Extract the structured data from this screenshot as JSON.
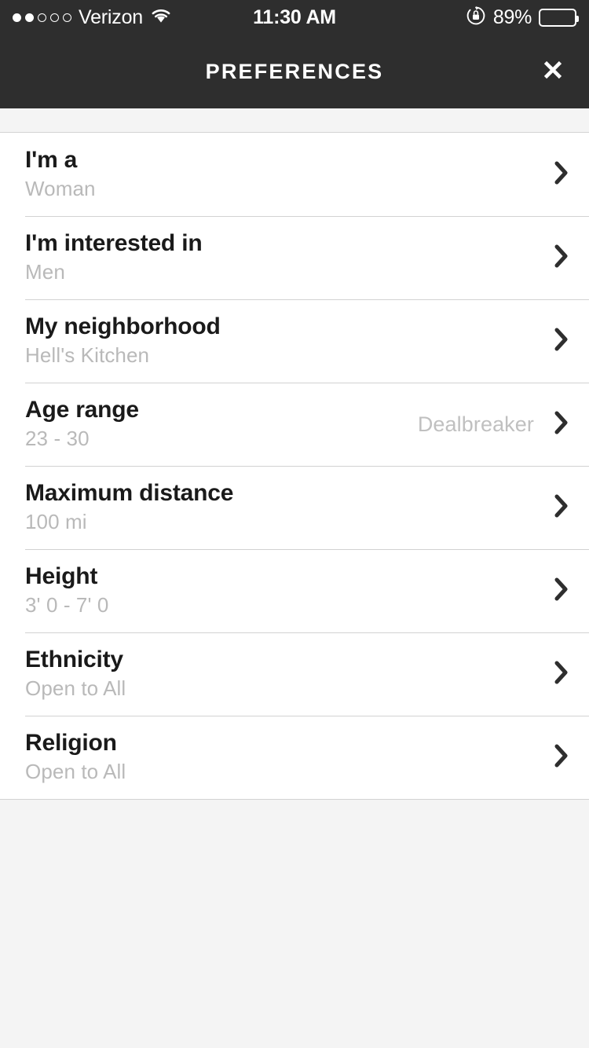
{
  "status_bar": {
    "carrier": "Verizon",
    "signal_dots_filled": 2,
    "signal_dots_total": 5,
    "wifi_icon": "wifi-icon",
    "time": "11:30 AM",
    "rotation_lock_icon": "rotation-lock-icon",
    "battery_percent": "89%",
    "battery_level": 89,
    "text_color": "#ffffff",
    "background": "#2e2e2e"
  },
  "header": {
    "title": "PREFERENCES",
    "close_icon": "close-icon",
    "background": "#2e2e2e"
  },
  "colors": {
    "page_background": "#f4f4f4",
    "list_background": "#ffffff",
    "title_text": "#1a1a1a",
    "subtitle_text": "#b9b9b9",
    "separator": "#d2d2d2",
    "chevron": "#2e2e2e"
  },
  "list": {
    "rows": [
      {
        "title": "I'm a",
        "subtitle": "Woman",
        "aside": "",
        "chevron_icon": "chevron-right-icon"
      },
      {
        "title": "I'm interested in",
        "subtitle": "Men",
        "aside": "",
        "chevron_icon": "chevron-right-icon"
      },
      {
        "title": "My neighborhood",
        "subtitle": "Hell's Kitchen",
        "aside": "",
        "chevron_icon": "chevron-right-icon"
      },
      {
        "title": "Age range",
        "subtitle": "23 - 30",
        "aside": "Dealbreaker",
        "chevron_icon": "chevron-right-icon"
      },
      {
        "title": "Maximum distance",
        "subtitle": "100 mi",
        "aside": "",
        "chevron_icon": "chevron-right-icon"
      },
      {
        "title": "Height",
        "subtitle": "3' 0 - 7' 0",
        "aside": "",
        "chevron_icon": "chevron-right-icon"
      },
      {
        "title": "Ethnicity",
        "subtitle": "Open to All",
        "aside": "",
        "chevron_icon": "chevron-right-icon"
      },
      {
        "title": "Religion",
        "subtitle": "Open to All",
        "aside": "",
        "chevron_icon": "chevron-right-icon"
      }
    ]
  }
}
